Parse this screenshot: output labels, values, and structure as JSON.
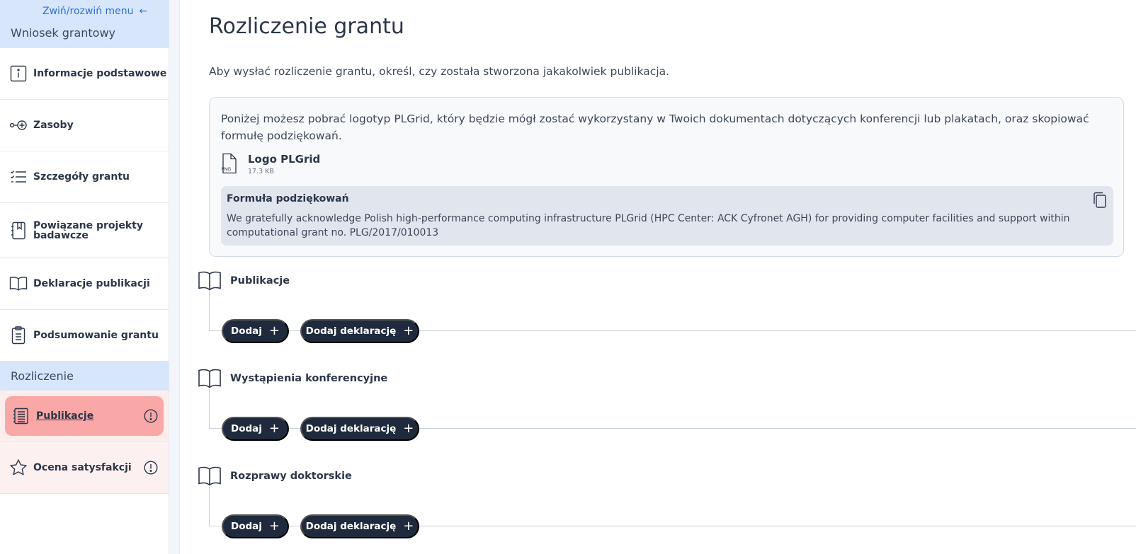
{
  "sidebar": {
    "collapse_label": "Zwiń/rozwiń menu",
    "section_grant": "Wniosek grantowy",
    "items": [
      {
        "label": "Informacje podstawowe",
        "icon": "info-icon"
      },
      {
        "label": "Zasoby",
        "icon": "resources-icon"
      },
      {
        "label": "Szczegóły grantu",
        "icon": "checklist-icon"
      },
      {
        "label": "Powiązane projekty badawcze",
        "icon": "bookmark-book-icon"
      },
      {
        "label": "Deklaracje publikacji",
        "icon": "open-book-icon"
      },
      {
        "label": "Podsumowanie grantu",
        "icon": "clipboard-icon"
      }
    ],
    "section_settlement": "Rozliczenie",
    "settlement_items": [
      {
        "label": "Publikacje",
        "icon": "document-list-icon",
        "active": true,
        "alert": true
      },
      {
        "label": "Ocena satysfakcji",
        "icon": "star-icon",
        "alert": true
      }
    ]
  },
  "main": {
    "title": "Rozliczenie grantu",
    "intro": "Aby wysłać rozliczenie grantu, określ, czy została stworzona jakakolwiek publikacja.",
    "info_text": "Poniżej możesz pobrać logotyp PLGrid, który będzie mógł zostać wykorzystany w Twoich dokumentach dotyczących konferencji lub plakatach, oraz skopiować formułę podziękowań.",
    "file": {
      "name": "Logo PLGrid",
      "size": "17.3 KB",
      "type": "PNG"
    },
    "formula": {
      "title": "Formuła podziękowań",
      "text": "We gratefully acknowledge Polish high-performance computing infrastructure PLGrid (HPC Center: ACK Cyfronet AGH) for providing computer facilities and support within computational grant no. PLG/2017/010013"
    },
    "sections": [
      {
        "title": "Publikacje",
        "add_label": "Dodaj",
        "declare_label": "Dodaj deklarację"
      },
      {
        "title": "Wystąpienia konferencyjne",
        "add_label": "Dodaj",
        "declare_label": "Dodaj deklarację"
      },
      {
        "title": "Rozprawy doktorskie",
        "add_label": "Dodaj",
        "declare_label": "Dodaj deklarację"
      }
    ]
  },
  "colors": {
    "accent": "#2f6fd8",
    "section_header_bg": "#d7e6fb",
    "active_item_bg": "#f9a7a7",
    "button_bg": "#1f2a3d"
  }
}
